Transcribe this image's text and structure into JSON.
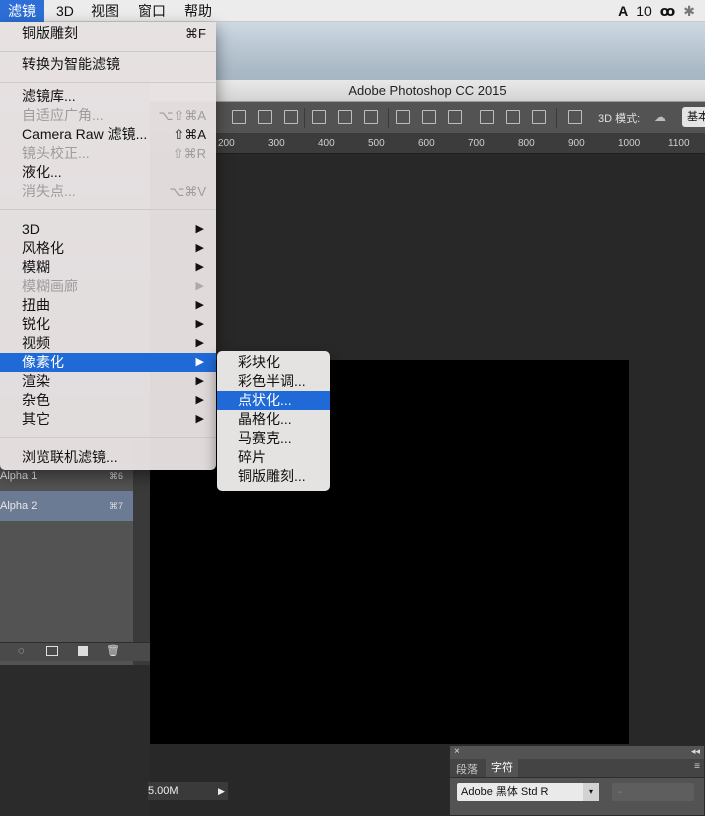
{
  "menubar": {
    "items": [
      "滤镜",
      "3D",
      "视图",
      "窗口",
      "帮助"
    ],
    "active_index": 0,
    "status_items": [
      "10"
    ]
  },
  "photoshop": {
    "title": "Adobe Photoshop CC 2015",
    "options_bar": {
      "mode_label": "3D 模式:",
      "workspace_label": "基本"
    },
    "ruler_ticks": [
      "200",
      "300",
      "400",
      "500",
      "600",
      "700",
      "800",
      "900",
      "1000",
      "1100"
    ],
    "status_text": "5.00M"
  },
  "channels_panel": {
    "rows": [
      {
        "label": "Alpha 1",
        "shortcut": "⌘6"
      },
      {
        "label": "Alpha 2",
        "shortcut": "⌘7"
      }
    ]
  },
  "type_panel": {
    "tabs": [
      "段落",
      "字符"
    ],
    "font_value": "Adobe 黑体 Std R",
    "style_value": "-"
  },
  "filter_menu": {
    "groups": [
      [
        {
          "label": "铜版雕刻",
          "shortcut": "⌘F",
          "disabled": false
        }
      ],
      [
        {
          "label": "转换为智能滤镜",
          "shortcut": "",
          "disabled": false
        }
      ],
      [
        {
          "label": "滤镜库...",
          "shortcut": "",
          "disabled": false
        },
        {
          "label": "自适应广角...",
          "shortcut": "⌥⇧⌘A",
          "disabled": true
        },
        {
          "label": "Camera Raw 滤镜...",
          "shortcut": "⇧⌘A",
          "disabled": false
        },
        {
          "label": "镜头校正...",
          "shortcut": "⇧⌘R",
          "disabled": true
        },
        {
          "label": "液化...",
          "shortcut": "",
          "disabled": false
        },
        {
          "label": "消失点...",
          "shortcut": "⌥⌘V",
          "disabled": true
        }
      ],
      [
        {
          "label": "3D",
          "submenu": true,
          "disabled": false
        },
        {
          "label": "风格化",
          "submenu": true,
          "disabled": false
        },
        {
          "label": "模糊",
          "submenu": true,
          "disabled": false
        },
        {
          "label": "模糊画廊",
          "submenu": true,
          "disabled": true
        },
        {
          "label": "扭曲",
          "submenu": true,
          "disabled": false
        },
        {
          "label": "锐化",
          "submenu": true,
          "disabled": false
        },
        {
          "label": "视频",
          "submenu": true,
          "disabled": false
        },
        {
          "label": "像素化",
          "submenu": true,
          "disabled": false,
          "highlighted": true
        },
        {
          "label": "渲染",
          "submenu": true,
          "disabled": false
        },
        {
          "label": "杂色",
          "submenu": true,
          "disabled": false
        },
        {
          "label": "其它",
          "submenu": true,
          "disabled": false
        }
      ],
      [
        {
          "label": "浏览联机滤镜...",
          "shortcut": "",
          "disabled": false
        }
      ]
    ]
  },
  "pixelate_submenu": {
    "items": [
      "彩块化",
      "彩色半调...",
      "点状化...",
      "晶格化...",
      "马赛克...",
      "碎片",
      "铜版雕刻..."
    ],
    "highlighted_index": 2
  },
  "colors": {
    "highlight": "#1f6ad6",
    "canvas": "#000000",
    "ps_bg": "#2b2b2b"
  }
}
